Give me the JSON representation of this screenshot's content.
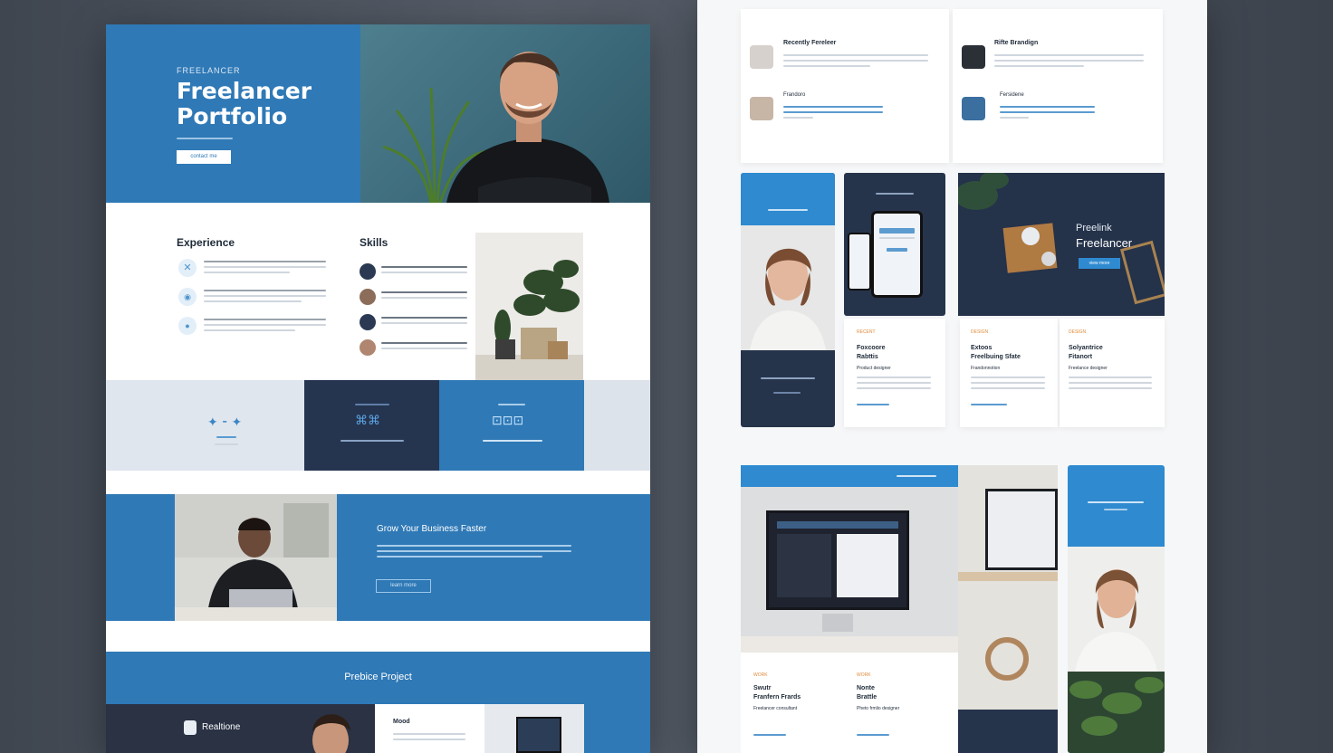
{
  "hero": {
    "eyebrow": "FREELANCER",
    "title_line1": "Freelancer",
    "title_line2": "Portfolio",
    "cta": "contact me"
  },
  "experience": {
    "title": "Experience"
  },
  "skills": {
    "title": "Skills"
  },
  "banner": {
    "title": "Grow Your Business Faster",
    "button": "learn more"
  },
  "projects": {
    "title": "Prebice Project",
    "card_name": "Realtione"
  },
  "right": {
    "testimonials": [
      {
        "name": "Recently Fereleer"
      },
      {
        "name": "Rifte Brandign"
      },
      {
        "name": "Frandoro"
      },
      {
        "name": "Fersidene"
      }
    ],
    "promo": {
      "line1": "Preelink",
      "line2": "Freelancer",
      "button": "view more"
    },
    "cards": [
      {
        "tag": "RECENT",
        "title_line1": "Foxcoore",
        "title_line2": "Rabttis",
        "sub": "Product designer"
      },
      {
        "tag": "DESIGN",
        "title_line1": "Extoos",
        "title_line2": "Freelbuing Sfate",
        "sub": "Frandonnotion"
      },
      {
        "tag": "DESIGN",
        "title_line1": "Solyantrice",
        "title_line2": "Fitanort",
        "sub": "Freelance designer"
      }
    ],
    "bottom_cards": [
      {
        "tag": "WORK",
        "title_line1": "Swutr",
        "title_line2": "Franfern Frards",
        "sub": "Freelancer consultant"
      },
      {
        "tag": "WORK",
        "title_line1": "Nonte",
        "title_line2": "Brattle",
        "sub": "Pheto frmlio designer"
      }
    ]
  },
  "colors": {
    "accent": "#2f79b6",
    "navy": "#26344b",
    "bg": "#4a515c"
  }
}
